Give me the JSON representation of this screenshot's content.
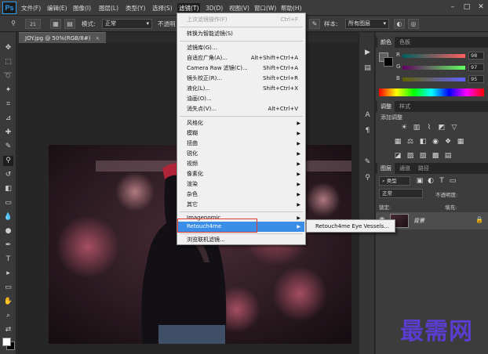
{
  "app": {
    "logo": "Ps",
    "menus": [
      "文件(F)",
      "编辑(E)",
      "图像(I)",
      "图层(L)",
      "类型(Y)",
      "选择(S)",
      "滤镜(T)",
      "3D(D)",
      "视图(V)",
      "窗口(W)",
      "帮助(H)"
    ],
    "active_menu_index": 6,
    "window_controls": [
      "–",
      "□",
      "✕"
    ]
  },
  "options": {
    "brush_size": "21",
    "mode_label": "模式:",
    "mode_value": "正常",
    "opacity_label": "不透明",
    "sample_label": "样本:",
    "sample_value": "所有图层"
  },
  "document": {
    "tab_title": "JOY.jpg @ 50%(RGB/8#)",
    "tab_close": "×"
  },
  "filter_menu": {
    "items": [
      {
        "label": "上次滤镜操作(F)",
        "shortcut": "Ctrl+F",
        "disabled": true
      },
      {
        "label": "转换为智能滤镜(S)",
        "shortcut": ""
      },
      {
        "label": "滤镜库(G)...",
        "shortcut": ""
      },
      {
        "label": "自适应广角(A)...",
        "shortcut": "Alt+Shift+Ctrl+A"
      },
      {
        "label": "Camera Raw 滤镜(C)...",
        "shortcut": "Shift+Ctrl+A"
      },
      {
        "label": "镜头校正(R)...",
        "shortcut": "Shift+Ctrl+R"
      },
      {
        "label": "液化(L)...",
        "shortcut": "Shift+Ctrl+X"
      },
      {
        "label": "油画(O)...",
        "shortcut": ""
      },
      {
        "label": "消失点(V)...",
        "shortcut": "Alt+Ctrl+V"
      },
      {
        "label": "风格化",
        "shortcut": "",
        "submenu": true
      },
      {
        "label": "模糊",
        "shortcut": "",
        "submenu": true
      },
      {
        "label": "扭曲",
        "shortcut": "",
        "submenu": true
      },
      {
        "label": "锐化",
        "shortcut": "",
        "submenu": true
      },
      {
        "label": "视频",
        "shortcut": "",
        "submenu": true
      },
      {
        "label": "像素化",
        "shortcut": "",
        "submenu": true
      },
      {
        "label": "渲染",
        "shortcut": "",
        "submenu": true
      },
      {
        "label": "杂色",
        "shortcut": "",
        "submenu": true
      },
      {
        "label": "其它",
        "shortcut": "",
        "submenu": true
      },
      {
        "label": "Imagenomic",
        "shortcut": "",
        "submenu": true
      },
      {
        "label": "Retouch4me",
        "shortcut": "",
        "submenu": true,
        "highlight": true
      },
      {
        "label": "浏览联机滤镜...",
        "shortcut": ""
      }
    ],
    "submenu_item": "Retouch4me Eye Vessels..."
  },
  "color_panel": {
    "tabs": [
      "颜色",
      "色板"
    ],
    "channels": [
      {
        "label": "R",
        "value": "98"
      },
      {
        "label": "G",
        "value": "97"
      },
      {
        "label": "B",
        "value": "95"
      }
    ]
  },
  "adjustments_panel": {
    "tabs": [
      "调整",
      "样式"
    ],
    "title": "添加调整"
  },
  "layers_panel": {
    "tabs": [
      "图层",
      "通道",
      "路径"
    ],
    "kind_filter": "类型",
    "blend_mode": "正常",
    "opacity_label": "不透明度:",
    "lock_label": "锁定:",
    "fill_label": "填充:",
    "layer_name": "背景"
  },
  "watermark": "最需网",
  "colors": {
    "menu_highlight": "#3a8ee8",
    "callout": "#e53935",
    "watermark": "#5a3ccf"
  }
}
